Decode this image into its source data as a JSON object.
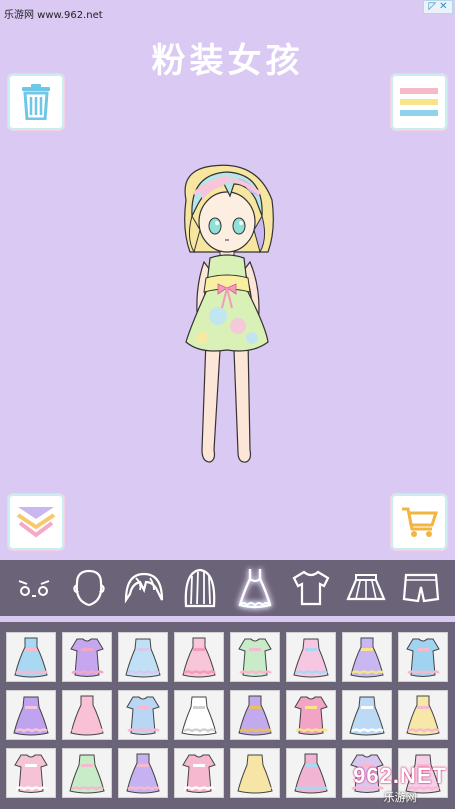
{
  "watermark_top": "乐游网 www.962.net",
  "ad_badge": "AD",
  "title": "粉装女孩",
  "colors": {
    "background": "#d9c9f3",
    "panel": "#6b6478",
    "tile": "#f3f3f3",
    "trash": "#6fc7e8",
    "menu_bars": [
      "#f6b9c8",
      "#f7e48c",
      "#8fd3ea"
    ],
    "cart": "#f2b53f"
  },
  "toolbar": {
    "trash_icon": "trash-icon",
    "menu_icon": "menu-icon",
    "down_icon": "chevron-down-icon",
    "cart_icon": "cart-icon"
  },
  "tabs": [
    {
      "name": "eyes",
      "icon": "eyes-icon",
      "active": false
    },
    {
      "name": "face",
      "icon": "face-icon",
      "active": false
    },
    {
      "name": "front-hair",
      "icon": "front-hair-icon",
      "active": false
    },
    {
      "name": "back-hair",
      "icon": "back-hair-icon",
      "active": false
    },
    {
      "name": "dress",
      "icon": "dress-icon",
      "active": true
    },
    {
      "name": "top",
      "icon": "tshirt-icon",
      "active": false
    },
    {
      "name": "skirt",
      "icon": "skirt-icon",
      "active": false
    },
    {
      "name": "shorts",
      "icon": "shorts-icon",
      "active": false
    }
  ],
  "items": [
    {
      "color": "#a9d8f2",
      "accent": "#f6b9d0"
    },
    {
      "color": "#c6a6ee",
      "accent": "#f2a7c9"
    },
    {
      "color": "#bfe0f5",
      "accent": "#d8c8f0"
    },
    {
      "color": "#f7c6d8",
      "accent": "#f59ab9"
    },
    {
      "color": "#c7ecc7",
      "accent": "#f6b9d0"
    },
    {
      "color": "#f7c6e0",
      "accent": "#a9d8f2"
    },
    {
      "color": "#c8b7f0",
      "accent": "#f7e48c"
    },
    {
      "color": "#9fd3f0",
      "accent": "#f6b9d0"
    },
    {
      "color": "#bfa3ee",
      "accent": "#f6c4dc"
    },
    {
      "color": "#f8c1d6",
      "accent": "#f8c1d6"
    },
    {
      "color": "#b9d6f5",
      "accent": "#f6b9d0"
    },
    {
      "color": "#ffffff",
      "accent": "#d0d0d0"
    },
    {
      "color": "#c3a9ee",
      "accent": "#e8c060"
    },
    {
      "color": "#f2a3c6",
      "accent": "#f7e48c"
    },
    {
      "color": "#bcd9f5",
      "accent": "#ffffff"
    },
    {
      "color": "#f7e8a8",
      "accent": "#f6b9d0"
    },
    {
      "color": "#f6c2d6",
      "accent": "#ffffff"
    },
    {
      "color": "#c7ecc7",
      "accent": "#f6b9d0"
    },
    {
      "color": "#c6b2f0",
      "accent": "#f6b9d0"
    },
    {
      "color": "#f5b8ce",
      "accent": "#ffffff"
    },
    {
      "color": "#f7e5a6",
      "accent": "#f7e5a6"
    },
    {
      "color": "#f1b4d3",
      "accent": "#a9d8f2"
    },
    {
      "color": "#d8c8f0",
      "accent": "#f6b9d0"
    },
    {
      "color": "#f3d0e8",
      "accent": "#f6b9d0"
    }
  ],
  "watermark_br": {
    "logo": "962",
    "suffix": ".NET",
    "sub": "乐游网"
  }
}
